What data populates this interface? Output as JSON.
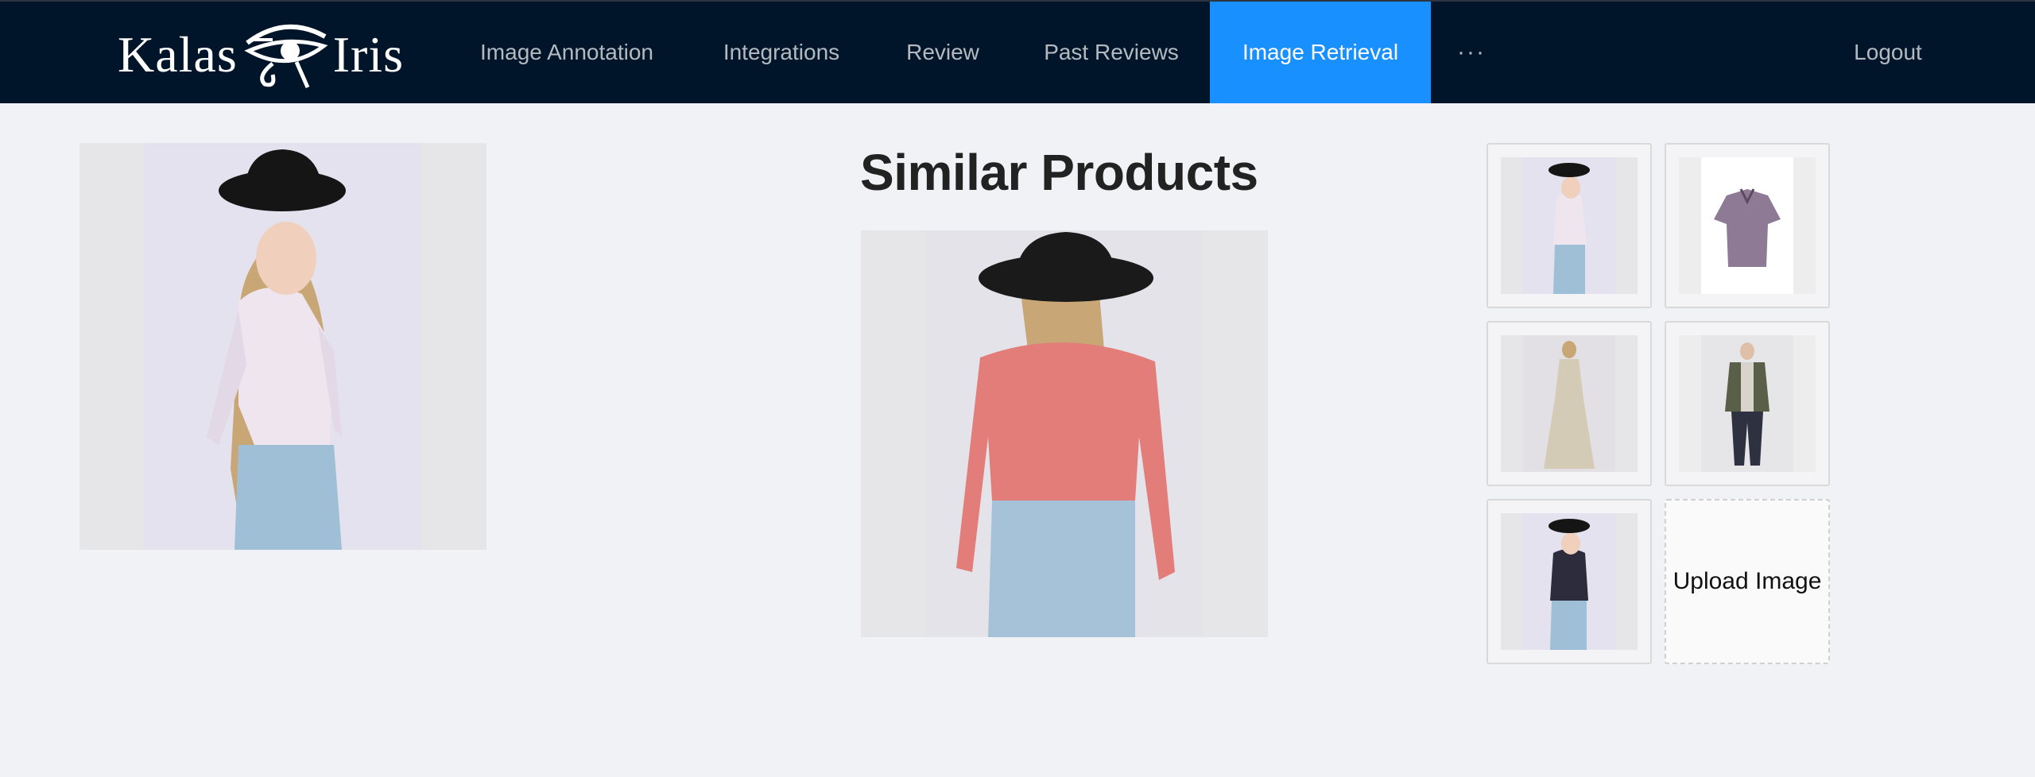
{
  "brand": {
    "logo_left": "Kalas",
    "logo_right": "Iris"
  },
  "nav": {
    "items": [
      {
        "label": "Image Annotation"
      },
      {
        "label": "Integrations"
      },
      {
        "label": "Review"
      },
      {
        "label": "Past Reviews"
      },
      {
        "label": "Image Retrieval",
        "active": true
      },
      {
        "label": "···"
      }
    ],
    "logout": "Logout"
  },
  "colors": {
    "navbar_bg": "#001529",
    "active_tab": "#1890ff",
    "page_bg": "#f0f2f5"
  },
  "main": {
    "title": "Similar Products",
    "upload_label": "Upload Image"
  },
  "icons": {
    "query": "woman-lace-top-hat-photo",
    "result": "woman-lace-top-back-photo",
    "thumbs": [
      "woman-white-lace-top",
      "floral-shirt",
      "long-dress",
      "man-varsity-jacket",
      "woman-dark-lace-top"
    ]
  }
}
